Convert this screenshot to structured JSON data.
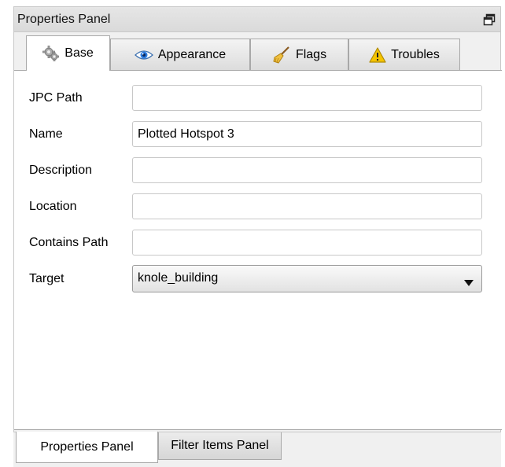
{
  "panel": {
    "title": "Properties Panel",
    "float_icon": "float-window-icon"
  },
  "tabs": [
    {
      "label": "Base",
      "icon": "gear-icon",
      "active": true
    },
    {
      "label": "Appearance",
      "icon": "eye-icon",
      "active": false
    },
    {
      "label": "Flags",
      "icon": "broom-icon",
      "active": false
    },
    {
      "label": "Troubles",
      "icon": "warning-icon",
      "active": false
    }
  ],
  "form": {
    "jpc_path": {
      "label": "JPC Path",
      "value": ""
    },
    "name": {
      "label": "Name",
      "value": "Plotted Hotspot 3"
    },
    "description": {
      "label": "Description",
      "value": ""
    },
    "location": {
      "label": "Location",
      "value": ""
    },
    "contains_path": {
      "label": "Contains Path",
      "value": ""
    },
    "target": {
      "label": "Target",
      "value": "knole_building"
    }
  },
  "bottom_tabs": [
    {
      "label": "Properties Panel",
      "active": true
    },
    {
      "label": "Filter Items Panel",
      "active": false
    }
  ],
  "colors": {
    "warning": "#f5c400",
    "eye": "#2a7be0",
    "broom": "#e8b020"
  }
}
